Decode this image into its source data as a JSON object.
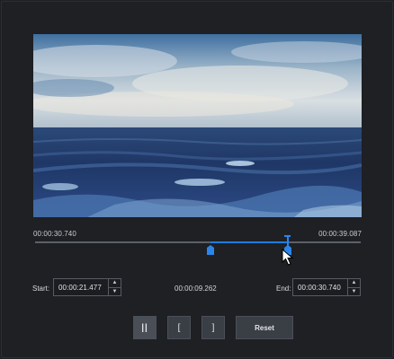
{
  "timeline": {
    "range_start": "00:00:30.740",
    "range_end": "00:00:39.087",
    "left_handle_position": 0.54,
    "right_handle_position": 0.775
  },
  "start": {
    "label": "Start:",
    "value": "00:00:21.477"
  },
  "end": {
    "label": "End:",
    "value": "00:00:30.740"
  },
  "duration": "00:00:09.262",
  "buttons": {
    "pause_glyph": "||",
    "mark_in_glyph": "[",
    "mark_out_glyph": "]",
    "reset_label": "Reset"
  },
  "spinner": {
    "up": "▲",
    "down": "▼"
  },
  "colors": {
    "accent": "#1e7be0",
    "background": "#1e2024"
  }
}
